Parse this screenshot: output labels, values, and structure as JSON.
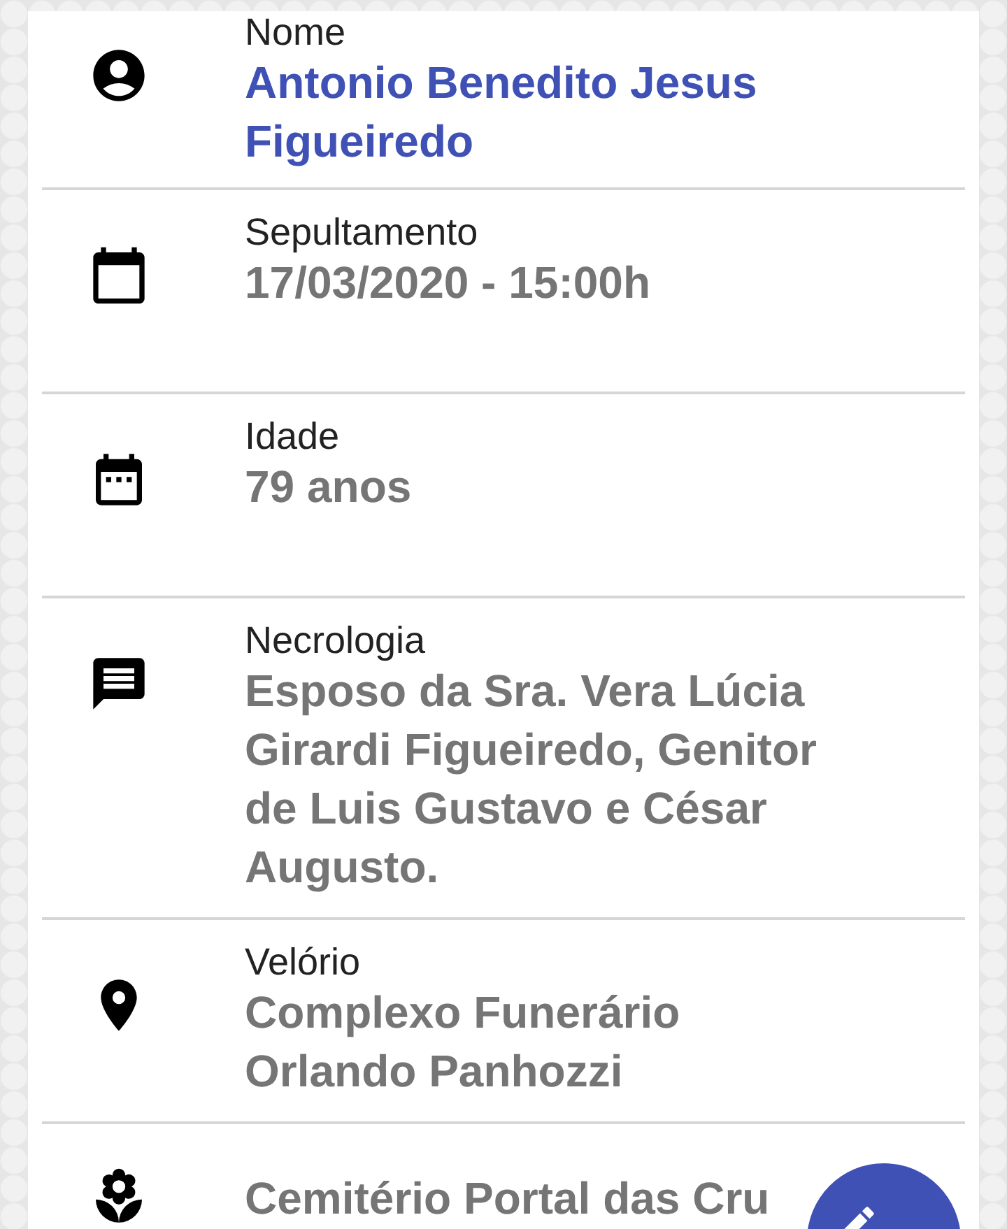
{
  "fields": [
    {
      "kind": "person",
      "label": "Nome",
      "value": "Antonio Benedito Jesus Figueiredo",
      "highlight": true
    },
    {
      "kind": "calendar",
      "label": "Sepultamento",
      "value": "17/03/2020 - 15:00h",
      "highlight": false
    },
    {
      "kind": "calendar-dots",
      "label": "Idade",
      "value": "79 anos",
      "highlight": false
    },
    {
      "kind": "message",
      "label": "Necrologia",
      "value": "Esposo da Sra. Vera Lúcia Girardi Figueiredo, Genitor de Luis Gustavo e César Augusto.",
      "highlight": false
    },
    {
      "kind": "place",
      "label": "Velório",
      "value": "Complexo Funerário Orlando Panhozzi",
      "highlight": false
    },
    {
      "kind": "flower",
      "value": "Cemitério Portal das Cru",
      "highlight": false
    }
  ],
  "fab": {
    "kind": "edit"
  }
}
